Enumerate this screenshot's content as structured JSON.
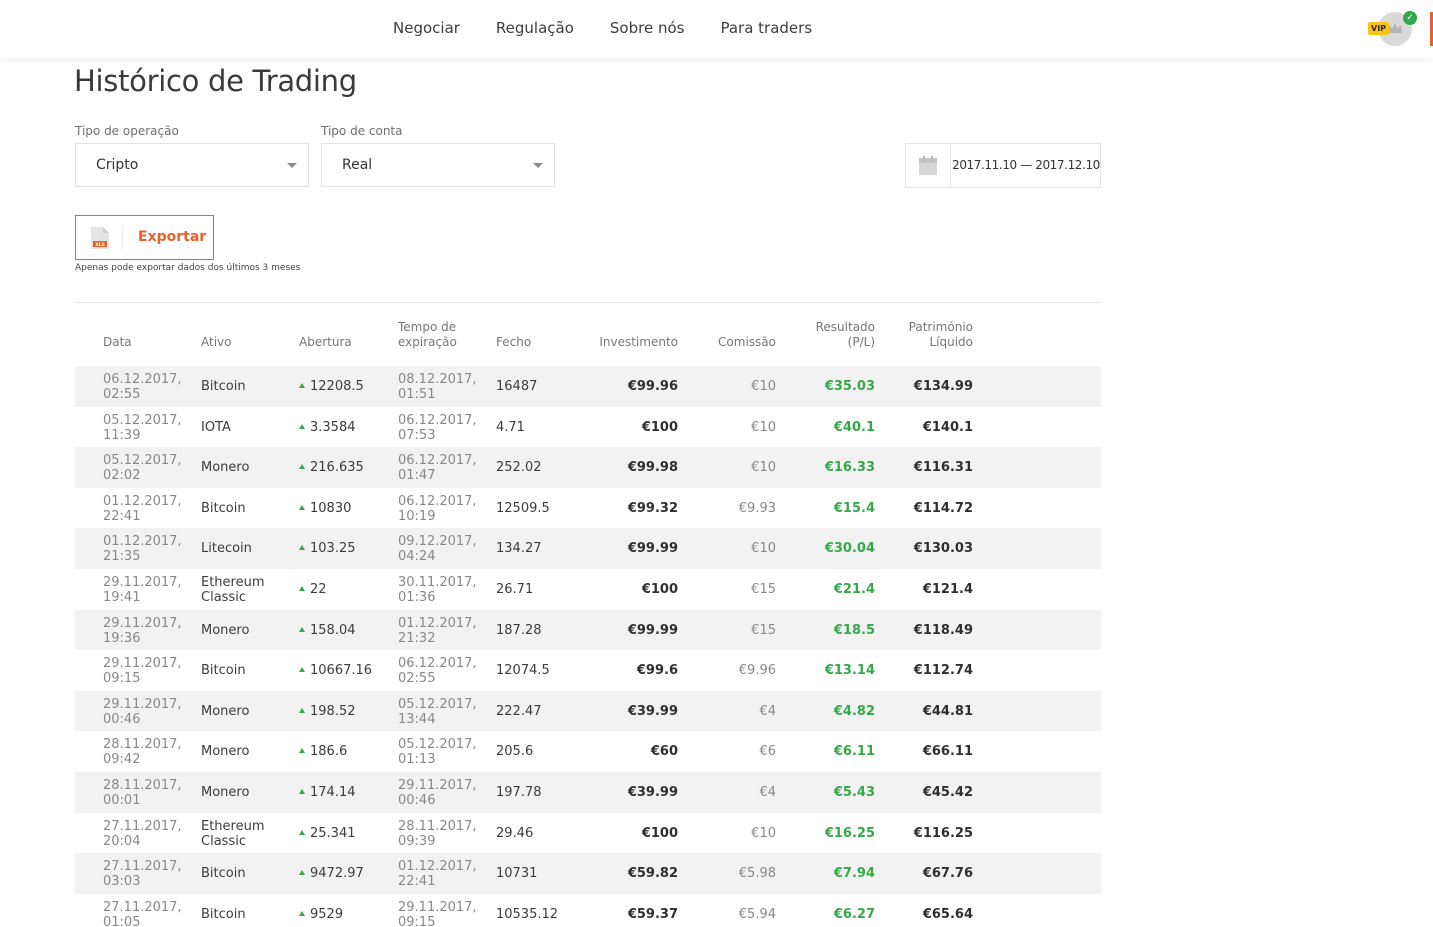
{
  "nav": {
    "items": [
      "Negociar",
      "Regulação",
      "Sobre nós",
      "Para traders"
    ],
    "vip_label": "VIP"
  },
  "page": {
    "title": "Histórico de Trading"
  },
  "filters": {
    "operation_type": {
      "label": "Tipo de operação",
      "value": "Cripto"
    },
    "account_type": {
      "label": "Tipo de conta",
      "value": "Real"
    },
    "date_range": "2017.11.10 — 2017.12.10"
  },
  "export": {
    "label": "Exportar",
    "file_badge": "XLS",
    "note": "Apenas pode exportar dados dos últimos 3 meses"
  },
  "table": {
    "headers": {
      "date": "Data",
      "asset": "Ativo",
      "open": "Abertura",
      "expiry_1": "Tempo de",
      "expiry_2": "expiração",
      "close": "Fecho",
      "investment": "Investimento",
      "commission": "Comissão",
      "result_1": "Resultado",
      "result_2": "(P/L)",
      "equity_1": "Património",
      "equity_2": "Líquido"
    },
    "rows": [
      {
        "date1": "06.12.2017,",
        "date2": "02:55",
        "asset1": "Bitcoin",
        "asset2": "",
        "open": "12208.5",
        "exp1": "08.12.2017,",
        "exp2": "01:51",
        "close": "16487",
        "investment": "€99.96",
        "commission": "€10",
        "result": "€35.03",
        "equity": "€134.99"
      },
      {
        "date1": "05.12.2017,",
        "date2": "11:39",
        "asset1": "IOTA",
        "asset2": "",
        "open": "3.3584",
        "exp1": "06.12.2017,",
        "exp2": "07:53",
        "close": "4.71",
        "investment": "€100",
        "commission": "€10",
        "result": "€40.1",
        "equity": "€140.1"
      },
      {
        "date1": "05.12.2017,",
        "date2": "02:02",
        "asset1": "Monero",
        "asset2": "",
        "open": "216.635",
        "exp1": "06.12.2017,",
        "exp2": "01:47",
        "close": "252.02",
        "investment": "€99.98",
        "commission": "€10",
        "result": "€16.33",
        "equity": "€116.31"
      },
      {
        "date1": "01.12.2017,",
        "date2": "22:41",
        "asset1": "Bitcoin",
        "asset2": "",
        "open": "10830",
        "exp1": "06.12.2017,",
        "exp2": "10:19",
        "close": "12509.5",
        "investment": "€99.32",
        "commission": "€9.93",
        "result": "€15.4",
        "equity": "€114.72"
      },
      {
        "date1": "01.12.2017,",
        "date2": "21:35",
        "asset1": "Litecoin",
        "asset2": "",
        "open": "103.25",
        "exp1": "09.12.2017,",
        "exp2": "04:24",
        "close": "134.27",
        "investment": "€99.99",
        "commission": "€10",
        "result": "€30.04",
        "equity": "€130.03"
      },
      {
        "date1": "29.11.2017,",
        "date2": "19:41",
        "asset1": "Ethereum",
        "asset2": "Classic",
        "open": "22",
        "exp1": "30.11.2017,",
        "exp2": "01:36",
        "close": "26.71",
        "investment": "€100",
        "commission": "€15",
        "result": "€21.4",
        "equity": "€121.4"
      },
      {
        "date1": "29.11.2017,",
        "date2": "19:36",
        "asset1": "Monero",
        "asset2": "",
        "open": "158.04",
        "exp1": "01.12.2017,",
        "exp2": "21:32",
        "close": "187.28",
        "investment": "€99.99",
        "commission": "€15",
        "result": "€18.5",
        "equity": "€118.49"
      },
      {
        "date1": "29.11.2017,",
        "date2": "09:15",
        "asset1": "Bitcoin",
        "asset2": "",
        "open": "10667.16",
        "exp1": "06.12.2017,",
        "exp2": "02:55",
        "close": "12074.5",
        "investment": "€99.6",
        "commission": "€9.96",
        "result": "€13.14",
        "equity": "€112.74"
      },
      {
        "date1": "29.11.2017,",
        "date2": "00:46",
        "asset1": "Monero",
        "asset2": "",
        "open": "198.52",
        "exp1": "05.12.2017,",
        "exp2": "13:44",
        "close": "222.47",
        "investment": "€39.99",
        "commission": "€4",
        "result": "€4.82",
        "equity": "€44.81"
      },
      {
        "date1": "28.11.2017,",
        "date2": "09:42",
        "asset1": "Monero",
        "asset2": "",
        "open": "186.6",
        "exp1": "05.12.2017,",
        "exp2": "01:13",
        "close": "205.6",
        "investment": "€60",
        "commission": "€6",
        "result": "€6.11",
        "equity": "€66.11"
      },
      {
        "date1": "28.11.2017,",
        "date2": "00:01",
        "asset1": "Monero",
        "asset2": "",
        "open": "174.14",
        "exp1": "29.11.2017,",
        "exp2": "00:46",
        "close": "197.78",
        "investment": "€39.99",
        "commission": "€4",
        "result": "€5.43",
        "equity": "€45.42"
      },
      {
        "date1": "27.11.2017,",
        "date2": "20:04",
        "asset1": "Ethereum",
        "asset2": "Classic",
        "open": "25.341",
        "exp1": "28.11.2017,",
        "exp2": "09:39",
        "close": "29.46",
        "investment": "€100",
        "commission": "€10",
        "result": "€16.25",
        "equity": "€116.25"
      },
      {
        "date1": "27.11.2017,",
        "date2": "03:03",
        "asset1": "Bitcoin",
        "asset2": "",
        "open": "9472.97",
        "exp1": "01.12.2017,",
        "exp2": "22:41",
        "close": "10731",
        "investment": "€59.82",
        "commission": "€5.98",
        "result": "€7.94",
        "equity": "€67.76"
      },
      {
        "date1": "27.11.2017,",
        "date2": "01:05",
        "asset1": "Bitcoin",
        "asset2": "",
        "open": "9529",
        "exp1": "29.11.2017,",
        "exp2": "09:15",
        "close": "10535.12",
        "investment": "€59.37",
        "commission": "€5.94",
        "result": "€6.27",
        "equity": "€65.64"
      }
    ]
  },
  "colors": {
    "accent": "#e8602c",
    "positive": "#35a84a",
    "row_shade": "#f2f2f2"
  }
}
